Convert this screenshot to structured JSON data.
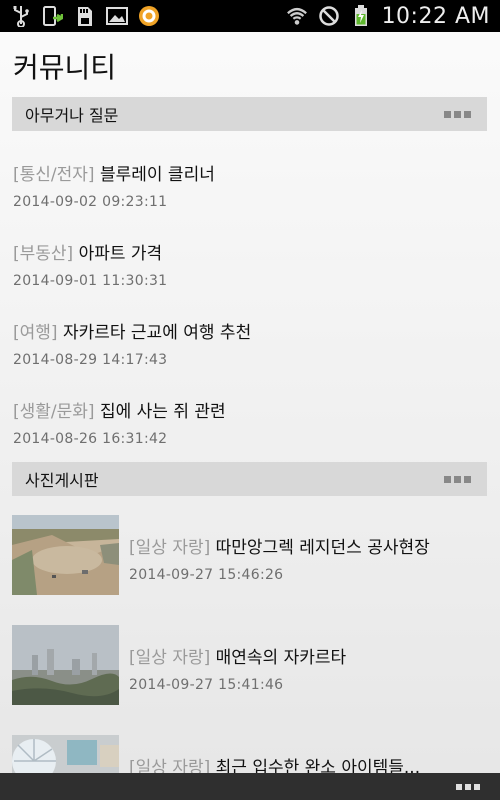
{
  "status_bar": {
    "time": "10:22 AM",
    "left_icons": [
      "usb-icon",
      "app-update-icon",
      "sd-card-icon",
      "image-icon",
      "app-circle-icon"
    ],
    "right_icons": [
      "wifi-icon",
      "no-signal-icon",
      "battery-charging-icon"
    ]
  },
  "page": {
    "title": "커뮤니티"
  },
  "sections": {
    "qa": {
      "title": "아무거나 질문",
      "items": [
        {
          "category": "[통신/전자]",
          "title": "블루레이 클리너",
          "date": "2014-09-02 09:23:11"
        },
        {
          "category": "[부동산]",
          "title": "아파트 가격",
          "date": "2014-09-01 11:30:31"
        },
        {
          "category": "[여행]",
          "title": "자카르타 근교에 여행 추천",
          "date": "2014-08-29 14:17:43"
        },
        {
          "category": "[생활/문화]",
          "title": "집에 사는 쥐 관련",
          "date": "2014-08-26 16:31:42"
        }
      ]
    },
    "photos": {
      "title": "사진게시판",
      "items": [
        {
          "category": "[일상 자랑]",
          "title": "따만앙그렉 레지던스 공사현장",
          "date": "2014-09-27 15:46:26"
        },
        {
          "category": "[일상 자랑]",
          "title": "매연속의 자카르타",
          "date": "2014-09-27 15:41:46"
        },
        {
          "category": "[일상 자랑]",
          "title": "최근 입수한 완소 아이템들...",
          "date": ""
        }
      ]
    }
  },
  "colors": {
    "section_header_bg": "#d8d8d8",
    "category_text": "#9a9a9a",
    "date_text": "#6f6f6f",
    "bottom_bar": "#2f2f2f"
  }
}
